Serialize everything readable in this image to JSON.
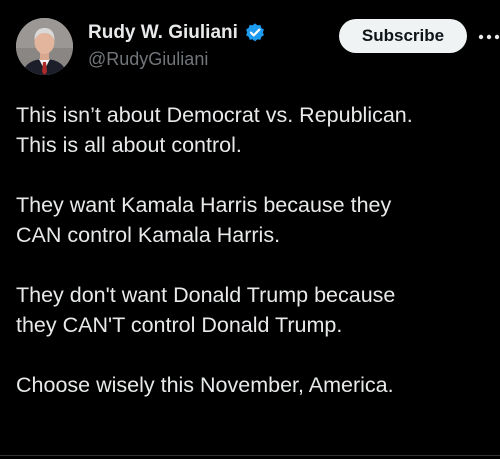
{
  "author": {
    "display_name": "Rudy W. Giuliani",
    "handle": "@RudyGiuliani",
    "verified": true,
    "verified_color": "#1d9bf0"
  },
  "actions": {
    "subscribe_label": "Subscribe",
    "more_icon": "more-horizontal-icon"
  },
  "post": {
    "paragraphs": [
      {
        "lines": [
          "This isn’t about Democrat vs. Republican.",
          "This is all about control."
        ]
      },
      {
        "lines": [
          "They want Kamala Harris because they",
          "CAN control Kamala Harris."
        ]
      },
      {
        "lines": [
          "They don't want Donald Trump because",
          "they CAN'T control Donald Trump."
        ]
      },
      {
        "lines": [
          "Choose wisely this November, America."
        ]
      }
    ]
  },
  "theme": {
    "background": "#000000",
    "text": "#e7e9ea",
    "muted_text": "#71767b",
    "button_bg": "#eff3f4"
  }
}
